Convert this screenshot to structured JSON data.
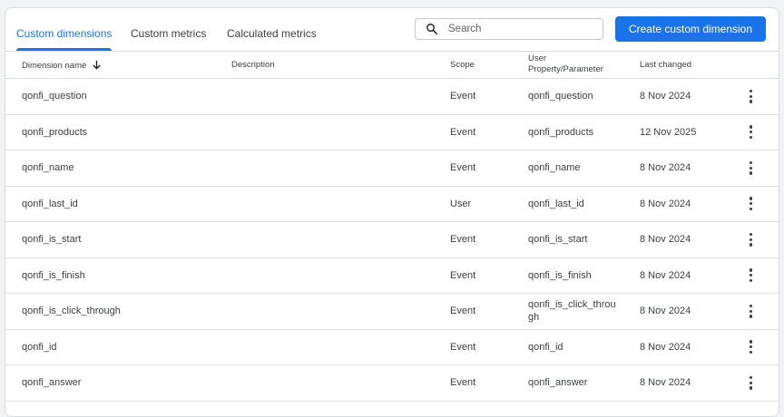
{
  "tabs": [
    {
      "label": "Custom dimensions",
      "active": true
    },
    {
      "label": "Custom metrics",
      "active": false
    },
    {
      "label": "Calculated metrics",
      "active": false
    }
  ],
  "search": {
    "placeholder": "Search",
    "icon": "search-icon"
  },
  "create_button": {
    "label": "Create custom dimension"
  },
  "table": {
    "headers": {
      "name": "Dimension name",
      "description": "Description",
      "scope": "Scope",
      "param": "User Property/Parameter",
      "last_changed": "Last changed"
    },
    "sort": {
      "column": "name",
      "direction": "descending",
      "icon": "arrow-down-icon"
    },
    "rows": [
      {
        "name": "qonfi_question",
        "description": "",
        "scope": "Event",
        "param": "qonfi_question",
        "last_changed": "8 Nov 2024"
      },
      {
        "name": "qonfi_products",
        "description": "",
        "scope": "Event",
        "param": "qonfi_products",
        "last_changed": "12 Nov 2025"
      },
      {
        "name": "qonfi_name",
        "description": "",
        "scope": "Event",
        "param": "qonfi_name",
        "last_changed": "8 Nov 2024"
      },
      {
        "name": "qonfi_last_id",
        "description": "",
        "scope": "User",
        "param": "qonfi_last_id",
        "last_changed": "8 Nov 2024"
      },
      {
        "name": "qonfi_is_start",
        "description": "",
        "scope": "Event",
        "param": "qonfi_is_start",
        "last_changed": "8 Nov 2024"
      },
      {
        "name": "qonfi_is_finish",
        "description": "",
        "scope": "Event",
        "param": "qonfi_is_finish",
        "last_changed": "8 Nov 2024"
      },
      {
        "name": "qonfi_is_click_through",
        "description": "",
        "scope": "Event",
        "param": "qonfi_is_click_through",
        "last_changed": "8 Nov 2024"
      },
      {
        "name": "qonfi_id",
        "description": "",
        "scope": "Event",
        "param": "qonfi_id",
        "last_changed": "8 Nov 2024"
      },
      {
        "name": "qonfi_answer",
        "description": "",
        "scope": "Event",
        "param": "qonfi_answer",
        "last_changed": "8 Nov 2024"
      }
    ],
    "row_menu_icon": "more-vert-icon"
  },
  "colors": {
    "accent": "#1a73e8",
    "text": "#3c4043",
    "border": "#dadce0",
    "page_background": "#f1f3f4"
  }
}
